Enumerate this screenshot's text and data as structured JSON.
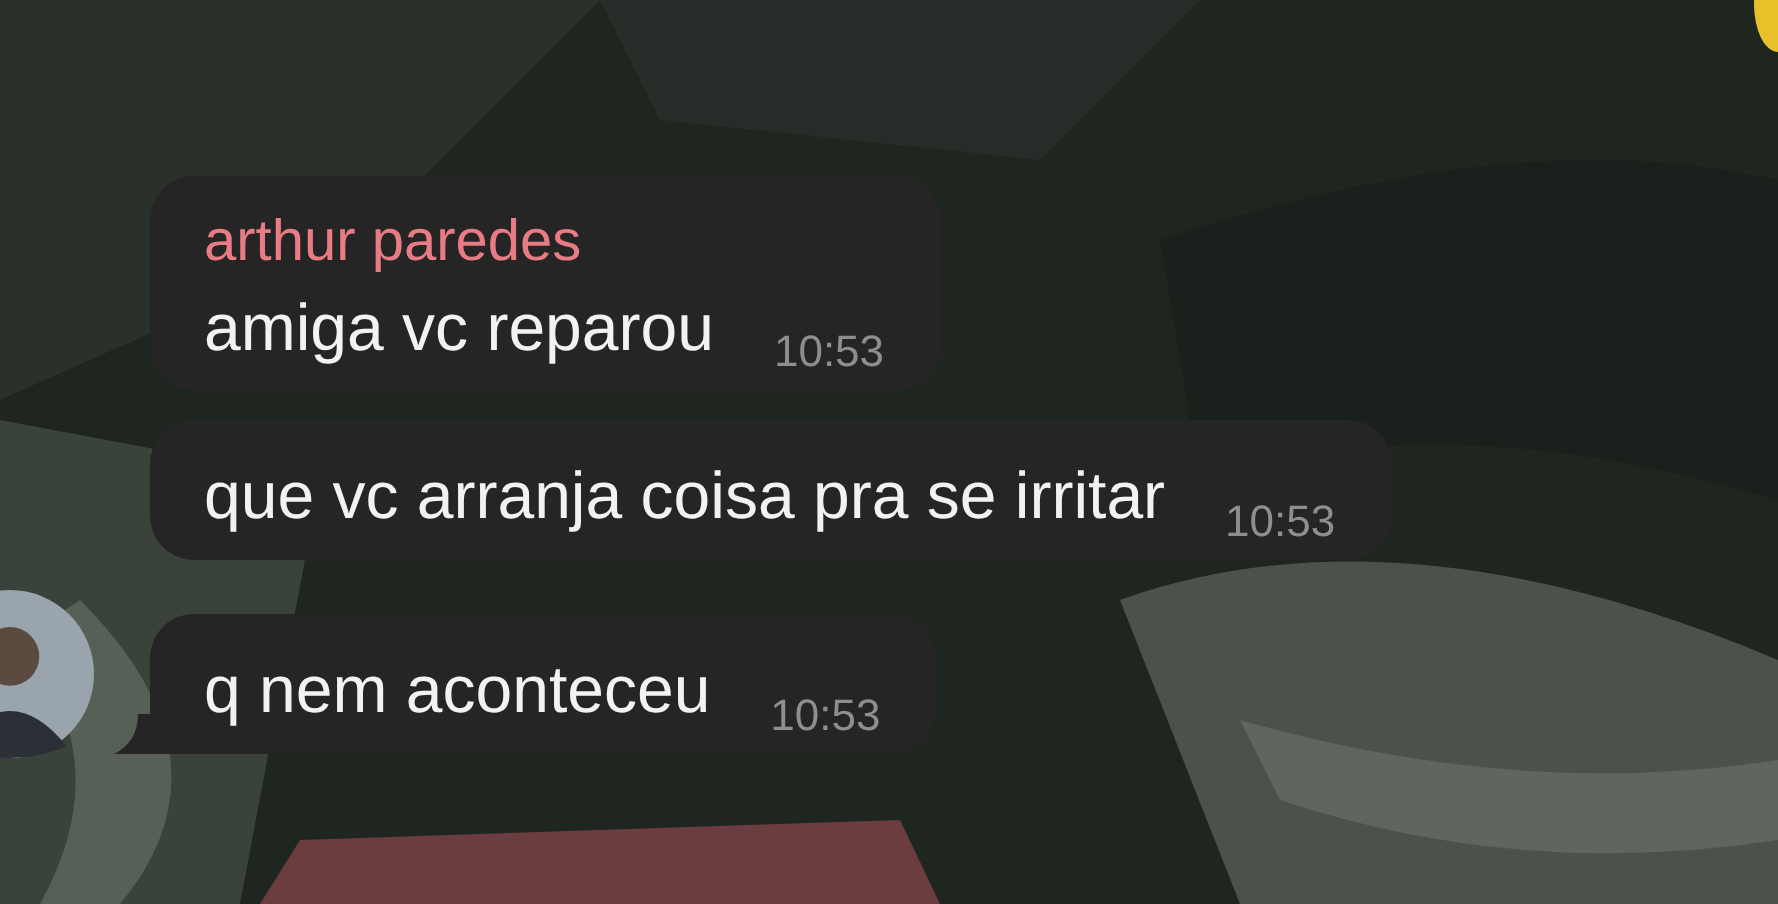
{
  "messages": [
    {
      "sender": "arthur paredes",
      "text": "amiga vc reparou",
      "time": "10:53"
    },
    {
      "text": "que vc arranja coisa pra se irritar",
      "time": "10:53"
    },
    {
      "text": "q nem aconteceu",
      "time": "10:53"
    }
  ]
}
